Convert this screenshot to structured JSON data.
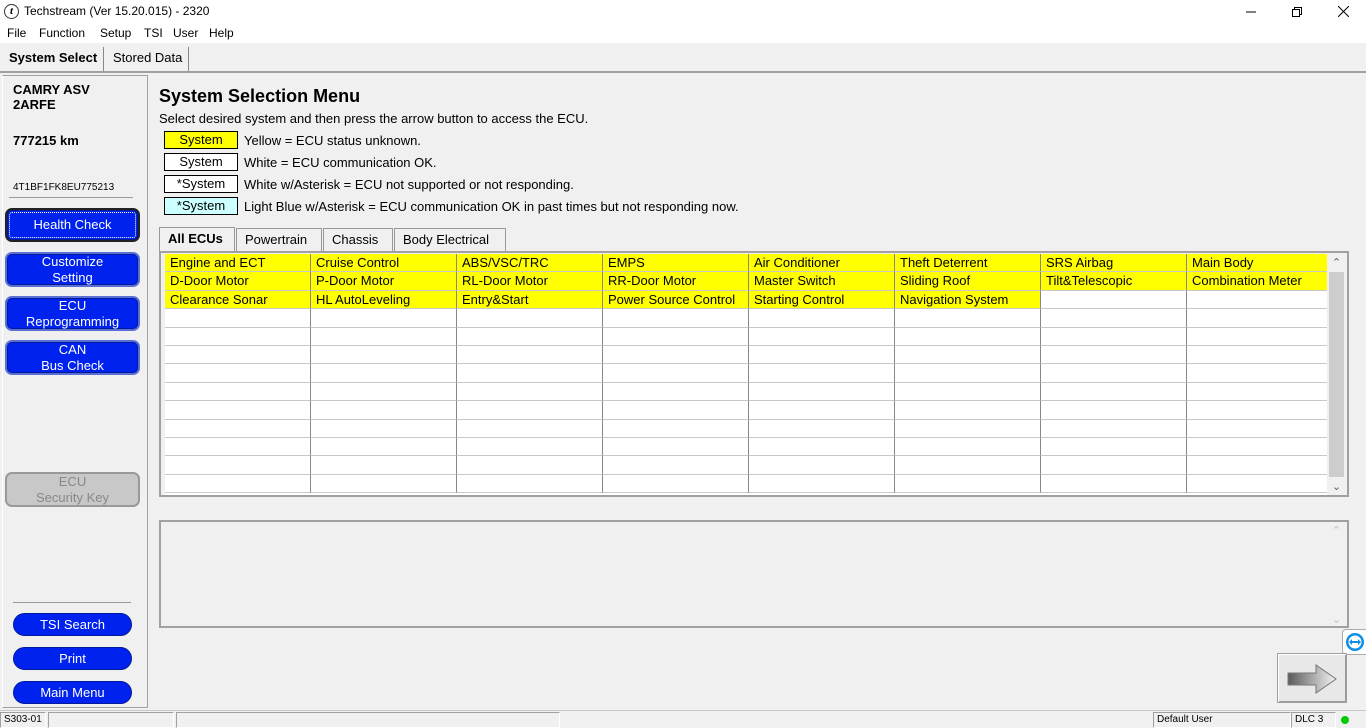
{
  "window": {
    "title": "Techstream (Ver 15.20.015) - 2320",
    "app_icon_glyph": "t",
    "minimize_icon": "minimize-icon",
    "maximize_icon": "restore-icon",
    "close_icon": "close-icon"
  },
  "menu": [
    "File",
    "Function",
    "Setup",
    "TSI",
    "User",
    "Help"
  ],
  "top_tabs": [
    "System Select",
    "Stored Data"
  ],
  "vehicle": {
    "model": "CAMRY ASV",
    "engine": "2ARFE",
    "odometer": "777215 km",
    "vin": "4T1BF1FK8EU775213"
  },
  "sidebar": {
    "health_check": "Health Check",
    "customize_l1": "Customize",
    "customize_l2": "Setting",
    "ecu_reprog_l1": "ECU",
    "ecu_reprog_l2": "Reprogramming",
    "can_l1": "CAN",
    "can_l2": "Bus Check",
    "ecu_key_l1": "ECU",
    "ecu_key_l2": "Security Key",
    "tsi_search": "TSI Search",
    "print": "Print",
    "main_menu": "Main Menu"
  },
  "main": {
    "title": "System Selection Menu",
    "instruction": "Select desired system and then press the arrow button to access the ECU."
  },
  "legend": [
    {
      "swatch": "System",
      "text": "Yellow = ECU status unknown.",
      "color": "#ffff00"
    },
    {
      "swatch": "System",
      "text": "White = ECU communication OK.",
      "color": "#ffffff"
    },
    {
      "swatch": "*System",
      "text": "White w/Asterisk = ECU not supported or not responding.",
      "color": "#ffffff"
    },
    {
      "swatch": "*System",
      "text": "Light Blue w/Asterisk = ECU communication OK in past times but not responding now.",
      "color": "#ccffff"
    }
  ],
  "ecu_tabs": [
    "All ECUs",
    "Powertrain",
    "Chassis",
    "Body Electrical"
  ],
  "ecu_grid": [
    [
      "Engine and ECT",
      "Cruise Control",
      "ABS/VSC/TRC",
      "EMPS",
      "Air Conditioner",
      "Theft Deterrent",
      "SRS Airbag",
      "Main Body"
    ],
    [
      "D-Door Motor",
      "P-Door Motor",
      "RL-Door Motor",
      "RR-Door Motor",
      "Master Switch",
      "Sliding Roof",
      "Tilt&Telescopic",
      "Combination Meter"
    ],
    [
      "Clearance Sonar",
      "HL AutoLeveling",
      "Entry&Start",
      "Power Source Control",
      "Starting Control",
      "Navigation System",
      "",
      ""
    ]
  ],
  "grid_empty_rows": 10,
  "colors": {
    "unknown_status": "#ffff00",
    "button_blue": "#0022ee",
    "connection_led": "#00cc00"
  },
  "statusbar": {
    "code": "S303-01",
    "field2": "",
    "field3": "",
    "user": "Default User",
    "connection": "DLC 3"
  }
}
